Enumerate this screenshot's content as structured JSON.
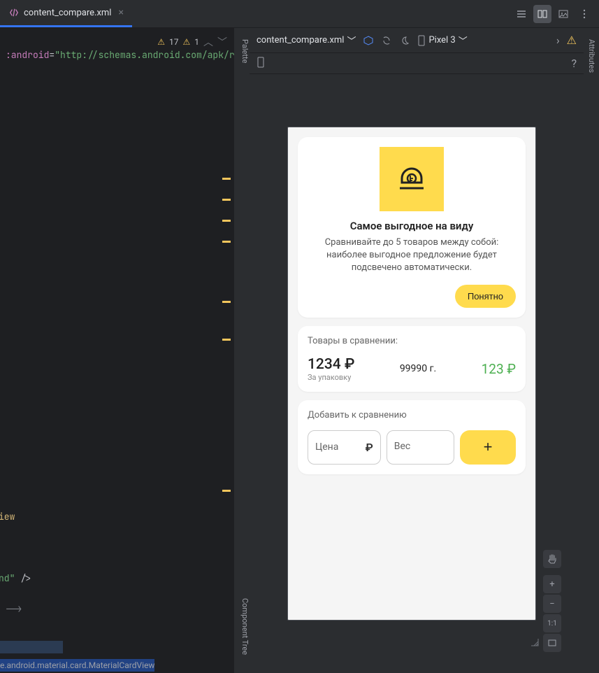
{
  "tab": {
    "name": "content_compare.xml"
  },
  "editor": {
    "warnings_major": "17",
    "warnings_minor": "1",
    "line1_ns": ":android",
    "line1_val": "\"http://schemas.android.com/apk/r",
    "line_iew": "iew",
    "line_nd": "nd\"",
    "line_slash": " />",
    "line_comment": "-->"
  },
  "preview": {
    "filename": "content_compare.xml",
    "device": "Pixel 3",
    "help": "?"
  },
  "app": {
    "card1": {
      "title": "Самое выгодное на виду",
      "desc": "Сравнивайте до 5 товаров между собой: наиболее выгодное предложение будет подсвечено автоматически.",
      "button": "Понятно"
    },
    "card2": {
      "label": "Товары в сравнении:",
      "price": "1234 ₽",
      "price_sub": "За упаковку",
      "weight": "99990 г.",
      "price_green": "123 ₽"
    },
    "card3": {
      "label": "Добавить к сравнению",
      "price_placeholder": "Цена",
      "weight_placeholder": "Вес",
      "ruble": "₽",
      "add": "+"
    }
  },
  "zoom": {
    "ratio": "1:1"
  },
  "status": {
    "text": "e.android.material.card.MaterialCardView"
  },
  "panels": {
    "palette": "Palette",
    "component_tree": "Component Tree",
    "attributes": "Attributes"
  }
}
